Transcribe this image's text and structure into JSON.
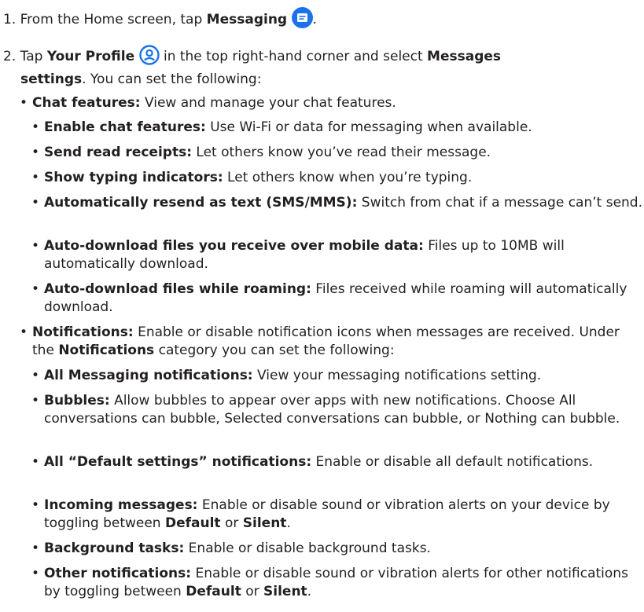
{
  "colors": {
    "messaging_icon_bg": "#1a73e8",
    "profile_icon": "#1a73e8"
  },
  "icons": {
    "messaging": "messaging-app-icon",
    "profile": "profile-icon"
  },
  "step1": {
    "num": "1.",
    "pre": "From the Home screen, tap ",
    "bold": "Messaging",
    "post": "."
  },
  "step2": {
    "num": "2.",
    "pre": "Tap ",
    "bold1": "Your Profile",
    "mid": " in the top right-hand corner and select ",
    "bold2": "Messages",
    "bold3": "settings",
    "post": ". You can set the following:"
  },
  "chat": {
    "bold": "Chat features:",
    "text": " View and manage your chat features.",
    "items": [
      {
        "bold": "Enable chat features:",
        "text": " Use Wi-Fi or data for messaging when available."
      },
      {
        "bold": "Send read receipts:",
        "text": " Let others know you’ve read their message."
      },
      {
        "bold": "Show typing indicators:",
        "text": " Let others know when you’re typing."
      },
      {
        "bold": "Automatically resend as text (SMS/MMS):",
        "text": " Switch from chat if a message can’t send."
      },
      {
        "bold": "Auto-download files you receive over mobile data:",
        "text": " Files up to 10MB will automatically download."
      },
      {
        "bold": "Auto-download files while roaming:",
        "text": " Files received while roaming will automatically download."
      }
    ]
  },
  "notif": {
    "bold": "Notifications:",
    "text1": " Enable or disable notification icons when messages are received. Under the ",
    "bold2": "Notifications",
    "text2": " category you can set the following:",
    "items": [
      {
        "bold": "All Messaging notifications:",
        "text": " View your messaging notifications setting."
      },
      {
        "bold": "Bubbles:",
        "text": " Allow bubbles to appear over apps with new notifications. Choose All conversations can bubble, Selected conversations can bubble, or Nothing can bubble."
      },
      {
        "bold": "All “Default settings” notifications:",
        "text": " Enable or disable all default notifications."
      },
      {
        "bold": "Incoming messages:",
        "text": " Enable or disable sound or vibration alerts on your device by toggling between ",
        "b2": "Default",
        "t2": " or ",
        "b3": "Silent",
        "t3": "."
      },
      {
        "bold": "Background tasks:",
        "text": " Enable or disable background tasks."
      },
      {
        "bold": "Other notifications:",
        "text": " Enable or disable sound or vibration alerts for other notifications by toggling between ",
        "b2": "Default",
        "t2": " or ",
        "b3": "Silent",
        "t3": "."
      }
    ]
  }
}
